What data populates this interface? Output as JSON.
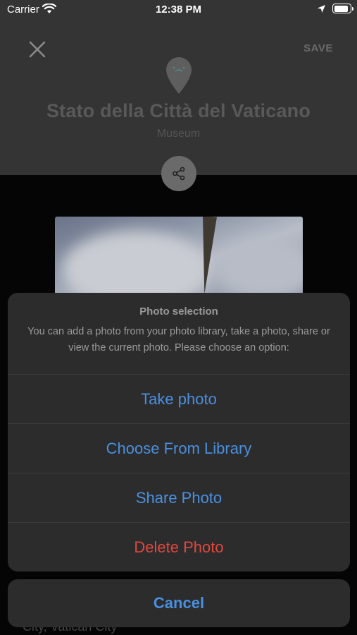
{
  "status_bar": {
    "carrier": "Carrier",
    "time": "12:38 PM",
    "icons": [
      "wifi-icon",
      "location-icon",
      "battery-icon"
    ]
  },
  "header": {
    "close_icon": "close-icon",
    "save_label": "SAVE",
    "pin_icon": "map-pin-icon",
    "pin_face": "·͜·",
    "title": "Stato della Città del Vaticano",
    "category": "Museum",
    "share_icon": "share-icon"
  },
  "photo": {
    "description_icon": "photo-thumbnail"
  },
  "behind_text": "City, Vatican City",
  "action_sheet": {
    "title": "Photo selection",
    "message": "You can add a photo from your photo library, take a photo, share or view the current photo. Please choose an option:",
    "actions": [
      {
        "label": "Take photo",
        "style": "default"
      },
      {
        "label": "Choose From Library",
        "style": "default"
      },
      {
        "label": "Share Photo",
        "style": "default"
      },
      {
        "label": "Delete Photo",
        "style": "destructive"
      }
    ],
    "cancel_label": "Cancel"
  },
  "colors": {
    "accent": "#4a90e0",
    "destructive": "#e0473f",
    "header_bg": "#343434",
    "sheet_bg": "#2c2c2d"
  }
}
